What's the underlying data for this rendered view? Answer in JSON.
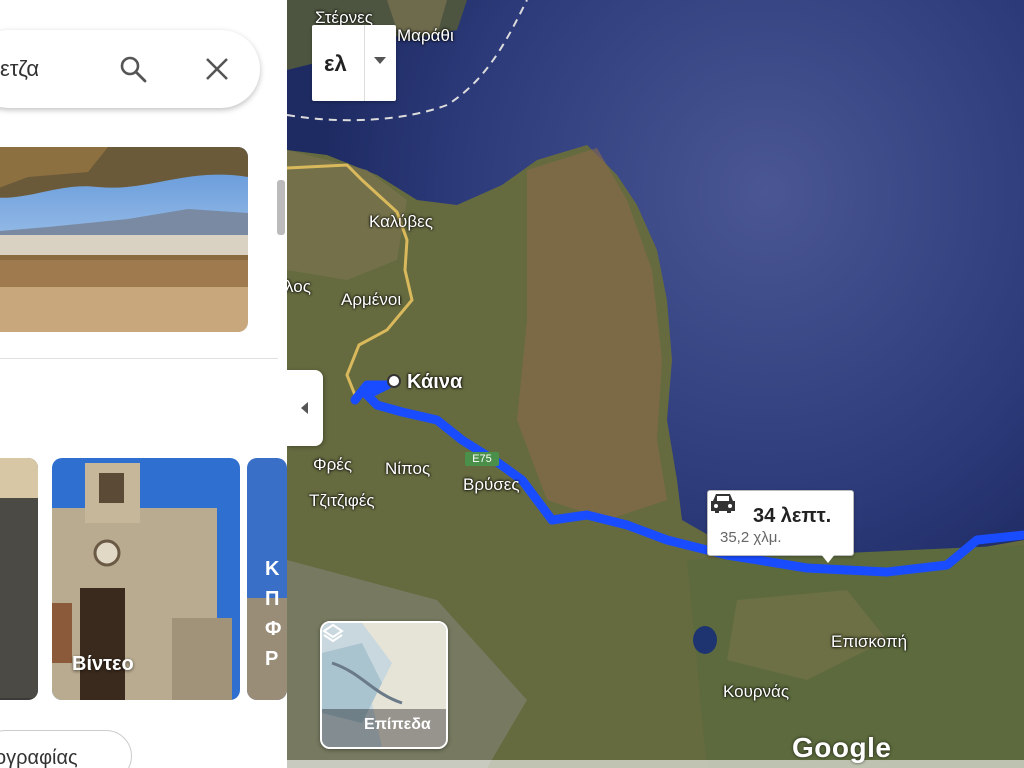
{
  "search": {
    "query": "ετζα"
  },
  "gallery": {
    "video_label": "Βίντεο",
    "partial_letters": [
      "Κ",
      "Π",
      "Φ",
      "Ρ"
    ]
  },
  "chip": {
    "label": "ογραφίας"
  },
  "map": {
    "language_label": "ελ",
    "route": {
      "time": "34 λεπτ.",
      "distance": "35,2 χλμ."
    },
    "layers_label": "Επίπεδα",
    "logo": "Google",
    "road_shield": "E75",
    "places": {
      "kaina": "Κάινα",
      "kalyves": "Καλύβες",
      "armenoi": "Αρμένοι",
      "los": "λος",
      "fres": "Φρές",
      "nipos": "Νίπος",
      "vryses": "Βρύσες",
      "tzitzifes": "Τζιτζιφές",
      "episkopi": "Επισκοπή",
      "kournas": "Κουρνάς",
      "marathi": "Μαράθι",
      "sternes": "Στέρνες"
    }
  },
  "colors": {
    "route": "#1a4cff",
    "sea": "#2c3a7a",
    "land": "#6b7043"
  }
}
